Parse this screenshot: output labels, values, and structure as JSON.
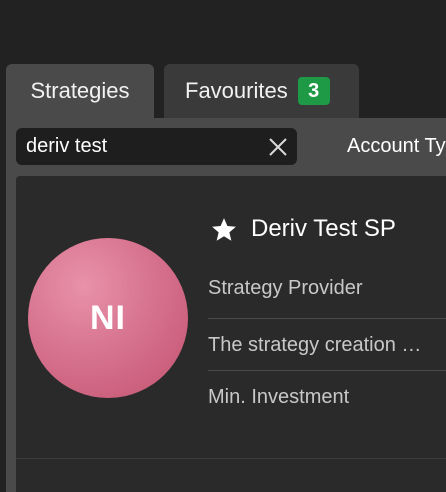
{
  "tabs": [
    {
      "label": "Strategies",
      "active": true
    },
    {
      "label": "Favourites",
      "active": false,
      "badge": "3"
    }
  ],
  "search": {
    "value": "deriv test",
    "clear_icon": "close-icon"
  },
  "filters": {
    "account_type_label": "Account Ty"
  },
  "strategy": {
    "avatar_initials": "NI",
    "favourite_icon": "star-icon",
    "name": "Deriv Test SP",
    "role": "Strategy Provider",
    "description": "The strategy creation …",
    "min_investment_label": "Min. Investment"
  },
  "colors": {
    "background": "#222222",
    "tab_active": "#4a4a4a",
    "tab_inactive": "#3a3a3a",
    "badge": "#1e9a47",
    "avatar": "#d7738f",
    "card": "#2a2a2a"
  }
}
